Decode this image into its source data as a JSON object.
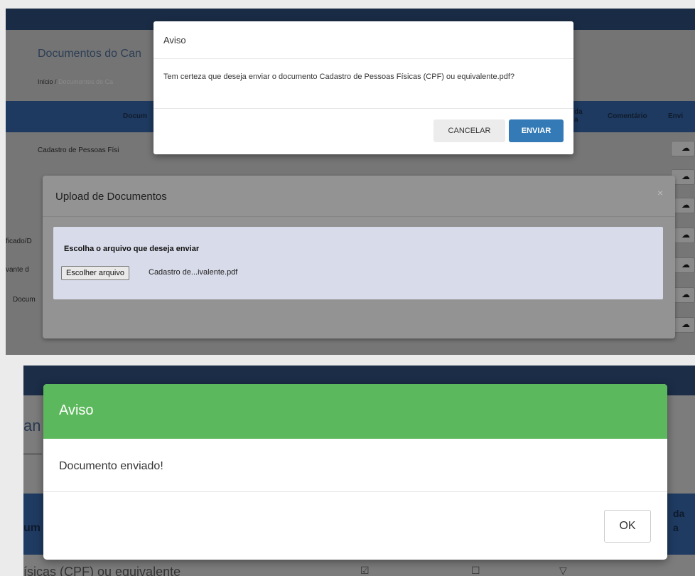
{
  "top": {
    "page_title": "Documentos do Can",
    "breadcrumb": {
      "home": "Início",
      "sep": "/",
      "current": "Documentos do Ca"
    },
    "table_headers": {
      "document": "Docum",
      "validated": "da\na",
      "comment": "Comentário",
      "send": "Envi"
    },
    "rows": [
      "Cadastro de Pessoas Físi",
      "ficado/D",
      "vante d",
      "Docum"
    ],
    "upload_icon": "cloud-upload-icon",
    "upload_dialog": {
      "title": "Upload de Documentos",
      "close": "×",
      "label": "Escolha o arquivo que deseja enviar",
      "choose_button": "Escolher arquivo",
      "file_name": "Cadastro de...ivalente.pdf"
    },
    "confirm_dialog": {
      "title": "Aviso",
      "message": "Tem certeza que deseja enviar o documento Cadastro de Pessoas Físicas (CPF) ou equivalente.pdf?",
      "cancel": "CANCELAR",
      "send": "ENVIAR"
    }
  },
  "bottom": {
    "title_fragment": "an",
    "table_header_doc": "um",
    "table_header_col": "da\na",
    "row_text": "ísicas (CPF) ou equivalente",
    "row_marks": [
      "☑",
      "☐",
      "▽"
    ],
    "dialog": {
      "title": "Aviso",
      "message": "Documento enviado!",
      "ok": "OK",
      "header_color": "#5cb85c"
    }
  },
  "colors": {
    "primary": "#337ab7",
    "success": "#5cb85c",
    "navbar": "#1a2c45"
  }
}
